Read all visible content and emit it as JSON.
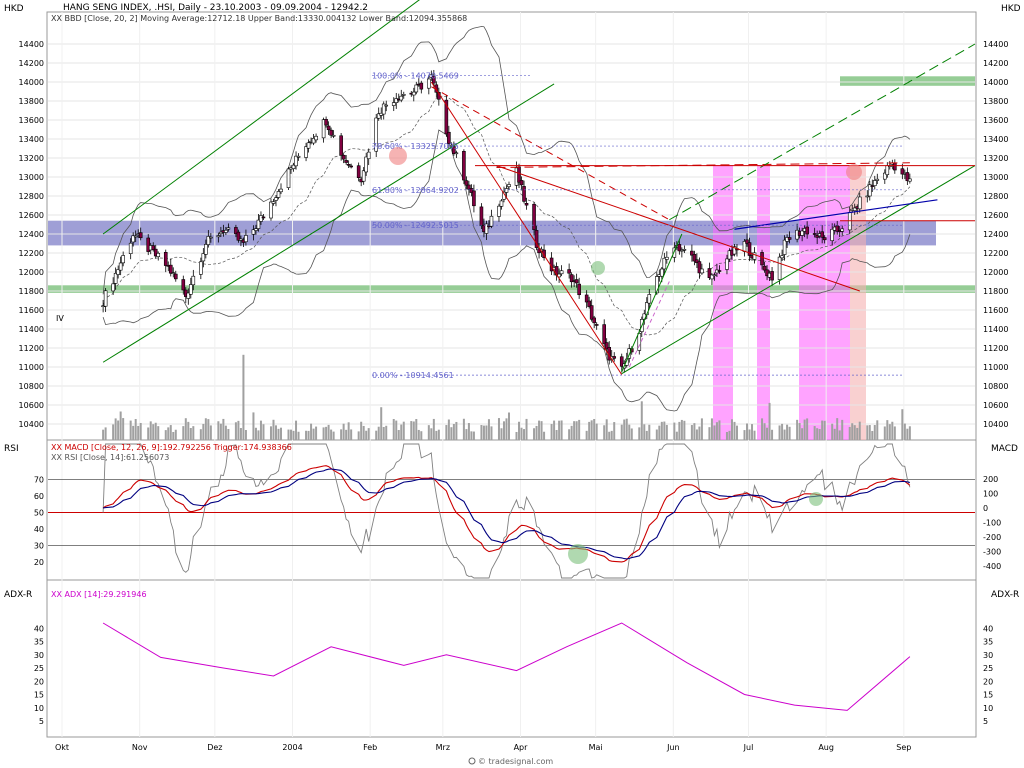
{
  "labels": {
    "currency_left": "HKD",
    "currency_right": "HKD",
    "rsi_left": "RSI",
    "macd_right": "MACD",
    "adx_left": "ADX-R",
    "adx_right": "ADX-R",
    "title": "HANG SENG INDEX, .HSI, Daily - 23.10.2003 - 09.09.2004 - 12942.2",
    "bollinger": "XX BBD [Close, 20, 2] Moving Average:12712.18 Upper Band:13330.004132 Lower Band:12094.355868",
    "macd": "XX MACD [Close, 12, 26, 9]:192.792256  Trigger:174.938366",
    "rsi": "XX RSI [Close, 14]:61.256073",
    "adx": "XX ADX [14]:29.291946",
    "wave_label": "IV",
    "watermark": "© tradesignal.com"
  },
  "chart_data": [
    {
      "type": "candlestick",
      "panel": "price",
      "title": "HANG SENG INDEX, .HSI, Daily - 23.10.2003 - 09.09.2004 - 12942.2",
      "yunit": "HKD",
      "ylim": [
        10250,
        14600
      ],
      "yticks": [
        10400,
        10600,
        10800,
        11000,
        11200,
        11400,
        11600,
        11800,
        12000,
        12200,
        12400,
        12600,
        12800,
        13000,
        13200,
        13400,
        13600,
        13800,
        14000,
        14200,
        14400
      ],
      "xticks": [
        "Okt",
        "Nov",
        "Dez",
        "2004",
        "Feb",
        "Mrz",
        "Apr",
        "Mai",
        "Jun",
        "Jul",
        "Aug",
        "Sep"
      ],
      "close_points": [
        [
          "2003-10-23",
          11700
        ],
        [
          "2003-10-28",
          11980
        ],
        [
          "2003-11-04",
          12400
        ],
        [
          "2003-11-12",
          12200
        ],
        [
          "2003-11-18",
          12050
        ],
        [
          "2003-11-25",
          11750
        ],
        [
          "2003-12-03",
          12300
        ],
        [
          "2003-12-10",
          12450
        ],
        [
          "2003-12-18",
          12300
        ],
        [
          "2003-12-26",
          12600
        ],
        [
          "2004-01-05",
          13050
        ],
        [
          "2004-01-12",
          13350
        ],
        [
          "2004-01-20",
          13600
        ],
        [
          "2004-01-27",
          13200
        ],
        [
          "2004-02-03",
          13000
        ],
        [
          "2004-02-10",
          13700
        ],
        [
          "2004-02-17",
          13850
        ],
        [
          "2004-02-24",
          13900
        ],
        [
          "2004-03-02",
          14050
        ],
        [
          "2004-03-09",
          13400
        ],
        [
          "2004-03-16",
          12950
        ],
        [
          "2004-03-23",
          12400
        ],
        [
          "2004-03-30",
          12800
        ],
        [
          "2004-04-05",
          13050
        ],
        [
          "2004-04-13",
          12300
        ],
        [
          "2004-04-20",
          12000
        ],
        [
          "2004-04-27",
          11950
        ],
        [
          "2004-05-04",
          11600
        ],
        [
          "2004-05-11",
          11150
        ],
        [
          "2004-05-17",
          10960
        ],
        [
          "2004-05-24",
          11400
        ],
        [
          "2004-05-31",
          11950
        ],
        [
          "2004-06-07",
          12300
        ],
        [
          "2004-06-14",
          12150
        ],
        [
          "2004-06-21",
          11900
        ],
        [
          "2004-06-28",
          12150
        ],
        [
          "2004-07-05",
          12300
        ],
        [
          "2004-07-12",
          12050
        ],
        [
          "2004-07-16",
          11950
        ],
        [
          "2004-07-22",
          12350
        ],
        [
          "2004-07-29",
          12450
        ],
        [
          "2004-08-05",
          12350
        ],
        [
          "2004-08-12",
          12450
        ],
        [
          "2004-08-19",
          12700
        ],
        [
          "2004-08-26",
          12950
        ],
        [
          "2004-09-02",
          13150
        ],
        [
          "2004-09-09",
          12942
        ]
      ],
      "bollinger": {
        "period": 20,
        "stddev": 2,
        "moving_average": 12712.18,
        "upper_band": 13330.004132,
        "lower_band": 12094.355868
      },
      "fibonacci": [
        {
          "level": "100.0%",
          "value": 14070.5469,
          "label": "100.0% - 14070.5469"
        },
        {
          "level": "78.6%",
          "value": 13325.7095,
          "label": "78.60% - 13325.7095"
        },
        {
          "level": "61.8%",
          "value": 12864.9202,
          "label": "61.80% - 12864.9202"
        },
        {
          "level": "50.0%",
          "value": 12492.5015,
          "label": "50.00% - 12492.5015"
        },
        {
          "level": "0.0%",
          "value": 10914.4561,
          "label": "0.00% - 10914.4561"
        }
      ],
      "zones": [
        {
          "name": "resistance-band-blue",
          "from": 12280,
          "to": 12540,
          "color": "#7f7fc8"
        },
        {
          "name": "support-band-green",
          "from": 11780,
          "to": 11860,
          "color": "#7cc07c"
        },
        {
          "name": "target-band-green",
          "from": 13960,
          "to": 14060,
          "color": "#7cc07c"
        }
      ],
      "annotations": [
        "IV"
      ]
    },
    {
      "type": "line",
      "panel": "macd-rsi",
      "series": [
        {
          "name": "MACD [Close, 12, 26, 9]",
          "last": 192.792256,
          "color": "#cc0000"
        },
        {
          "name": "Trigger",
          "last": 174.938366,
          "color": "#000080"
        },
        {
          "name": "RSI [Close, 14]",
          "last": 61.256073,
          "color": "#808080"
        }
      ],
      "rsi_ticks": [
        20,
        30,
        40,
        50,
        60,
        70
      ],
      "macd_ticks": [
        200,
        100,
        0,
        -100,
        -200,
        -300,
        -400
      ],
      "reference_lines": {
        "rsi_70": 70,
        "rsi_50": 50,
        "rsi_30": 30
      }
    },
    {
      "type": "line",
      "panel": "adx",
      "series": [
        {
          "name": "ADX [14]",
          "last": 29.291946,
          "color": "#cc00cc"
        }
      ],
      "yticks": [
        5,
        10,
        15,
        20,
        25,
        30,
        35,
        40
      ]
    }
  ],
  "colors": {
    "up_candle": "#ffffff",
    "down_candle": "#800040",
    "channel_green": "#008000",
    "channel_red": "#cc0000",
    "trend_blue": "#0000aa",
    "fib_line": "#6666cc",
    "highlight_magenta": "#ff66ff",
    "highlight_pink": "#f5b0b0"
  }
}
